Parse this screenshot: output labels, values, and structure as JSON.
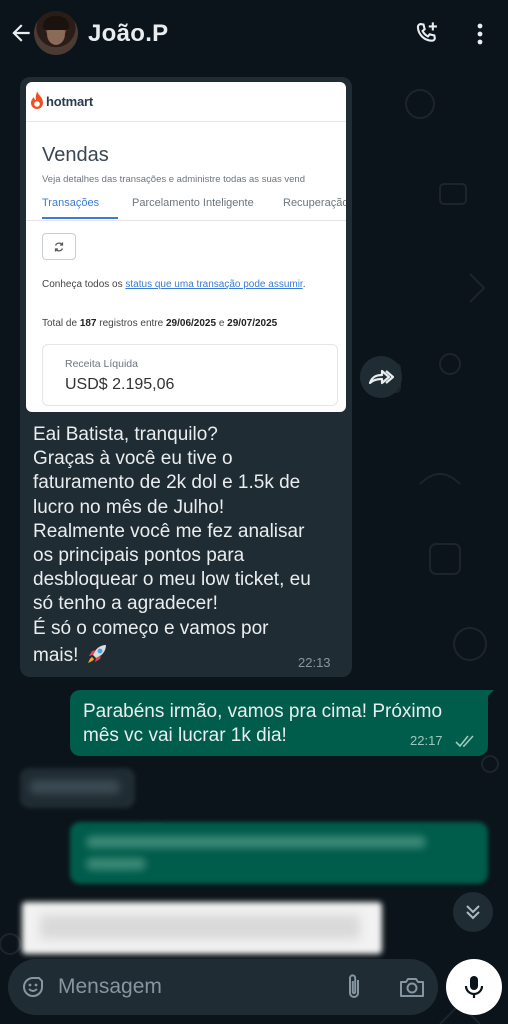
{
  "header": {
    "contact_name": "João.P",
    "back_icon": "arrow-back-icon",
    "call_icon": "add-call-icon",
    "menu_icon": "more-vert-icon"
  },
  "image_message": {
    "hotmart": {
      "brand": "hotmart",
      "brand_color": "#f04e23",
      "title": "Vendas",
      "subtitle": "Veja detalhes das transações e administre todas as suas vend",
      "tabs": [
        "Transações",
        "Parcelamento Inteligente",
        "Recuperação"
      ],
      "active_tab": "Transações",
      "info_prefix": "Conheça todos os ",
      "info_link": "status que uma transação pode assumir",
      "info_suffix": ".",
      "total_prefix": "Total de ",
      "total_count": "187",
      "total_mid": " registros entre ",
      "date_start": "29/06/2025",
      "date_join": " e ",
      "date_end": "29/07/2025",
      "card_label": "Receita Líquida",
      "card_value": "USD$ 2.195,06"
    },
    "text_lines": [
      "Eai Batista, tranquilo?",
      "Graças à você eu tive o",
      "faturamento de 2k dol  e 1.5k de",
      "lucro no mês de Julho!",
      "Realmente você me fez analisar",
      "os principais pontos para",
      "desbloquear o meu low ticket, eu",
      "só tenho a agradecer!",
      "É só o começo e vamos por",
      "mais!"
    ],
    "time": "22:13"
  },
  "outgoing_message": {
    "text": "Parabéns irmão, vamos pra cima! Próximo mês vc vai lucrar 1k dia!",
    "time": "22:17",
    "status": "read"
  },
  "composer": {
    "placeholder": "Mensagem"
  },
  "colors": {
    "background": "#0b141a",
    "incoming_bubble": "#202c33",
    "outgoing_bubble": "#005c4b",
    "read_ticks": "#9fc8bd"
  }
}
